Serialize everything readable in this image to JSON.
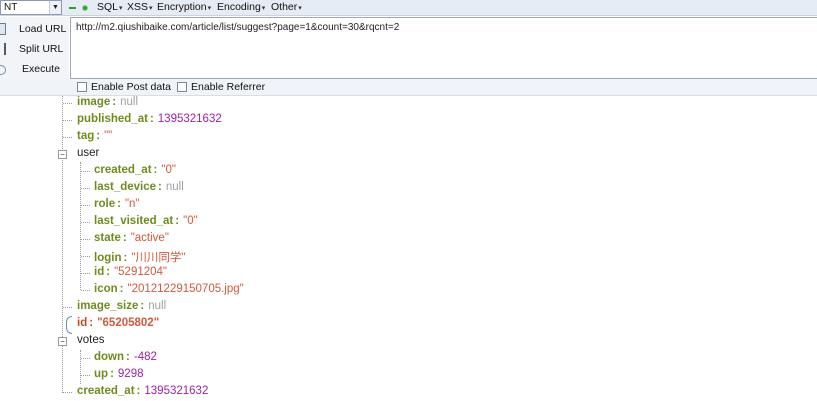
{
  "toolbar": {
    "select_value": "NT",
    "menus": [
      {
        "label": "SQL"
      },
      {
        "label": "XSS"
      },
      {
        "label": "Encryption"
      },
      {
        "label": "Encoding"
      },
      {
        "label": "Other"
      }
    ]
  },
  "sidebar": {
    "load_url": "Load URL",
    "split_url": "Split URL",
    "execute": "Execute"
  },
  "url_value": "http://m2.qiushibaike.com/article/list/suggest?page=1&count=30&rqcnt=2",
  "options": {
    "post_data": "Enable Post data",
    "referrer": "Enable Referrer"
  },
  "tree": [
    {
      "key": "image",
      "value": "null",
      "kind": "null"
    },
    {
      "key": "published_at",
      "value": "1395321632",
      "kind": "num"
    },
    {
      "key": "tag",
      "value": "\"\"",
      "kind": "str"
    },
    {
      "key": "user",
      "kind": "group"
    },
    {
      "key": "created_at",
      "value": "\"0\"",
      "kind": "str"
    },
    {
      "key": "last_device",
      "value": "null",
      "kind": "null"
    },
    {
      "key": "role",
      "value": "\"n\"",
      "kind": "str"
    },
    {
      "key": "last_visited_at",
      "value": "\"0\"",
      "kind": "str"
    },
    {
      "key": "state",
      "value": "\"active\"",
      "kind": "str"
    },
    {
      "key": "login",
      "value": "\"川川同学\"",
      "kind": "str"
    },
    {
      "key": "id",
      "value": "\"5291204\"",
      "kind": "str"
    },
    {
      "key": "icon",
      "value": "\"20121229150705.jpg\"",
      "kind": "str"
    },
    {
      "key": "image_size",
      "value": "null",
      "kind": "null"
    },
    {
      "key": "id",
      "value": "\"65205802\"",
      "kind": "str-hl"
    },
    {
      "key": "votes",
      "kind": "group"
    },
    {
      "key": "down",
      "value": "-482",
      "kind": "num"
    },
    {
      "key": "up",
      "value": "9298",
      "kind": "num"
    },
    {
      "key": "created_at",
      "value": "1395321632",
      "kind": "num"
    }
  ]
}
